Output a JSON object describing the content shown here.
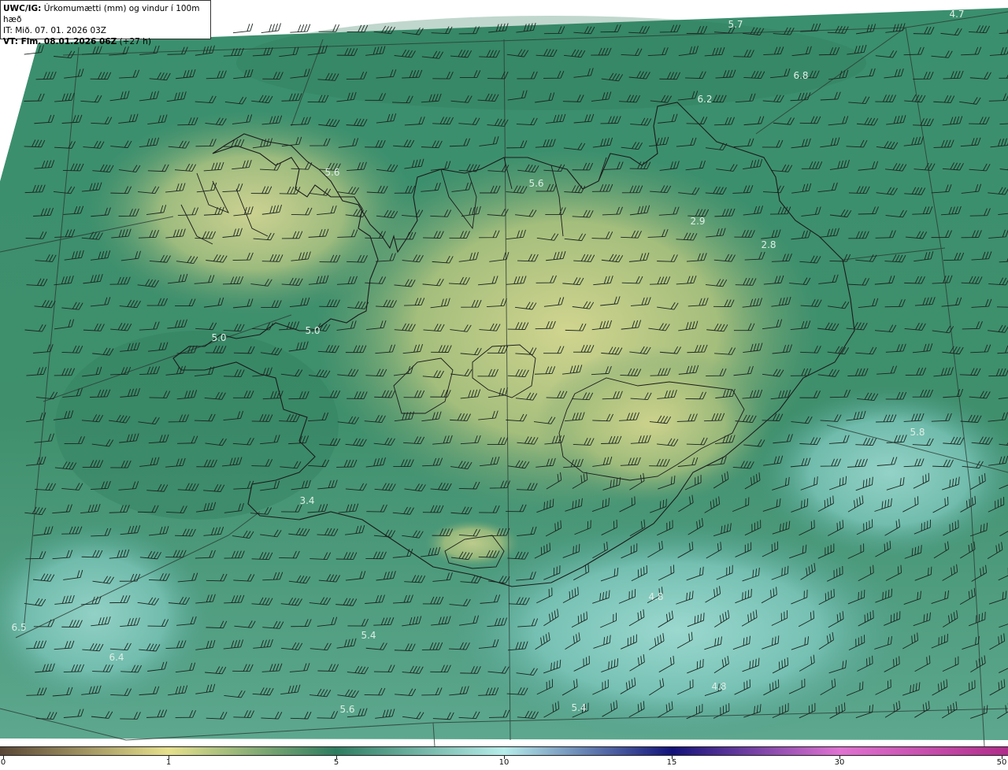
{
  "header": {
    "model": "UWC/IG:",
    "title": "Úrkomumætti (mm) og vindur í 100m hæð",
    "init_time": "IT: Mið. 07. 01. 2026 03Z",
    "valid_prefix": "VT: Fim. 08.01.2026 06Z",
    "valid_suffix": "(+27 h)"
  },
  "map_values": [
    {
      "text": "5.7"
    },
    {
      "text": "4.7"
    },
    {
      "text": "6.8"
    },
    {
      "text": "6.2"
    },
    {
      "text": "5.6"
    },
    {
      "text": "5.6"
    },
    {
      "text": "2.9"
    },
    {
      "text": "2.8"
    },
    {
      "text": "5.0"
    },
    {
      "text": "5.0"
    },
    {
      "text": "3.4"
    },
    {
      "text": "4.8"
    },
    {
      "text": "6.5"
    },
    {
      "text": "6.4"
    },
    {
      "text": "5.4"
    },
    {
      "text": "4.8"
    },
    {
      "text": "5.6"
    },
    {
      "text": "5.4"
    },
    {
      "text": "5.8"
    }
  ],
  "colorbar": {
    "ticks": [
      "0",
      "1",
      "5",
      "10",
      "15",
      "30",
      "50"
    ],
    "colors": [
      "#5a4636",
      "#e6e08c",
      "#2e7c60",
      "#b6ecea",
      "#12127a",
      "#e072d2",
      "#b02c8a"
    ]
  }
}
